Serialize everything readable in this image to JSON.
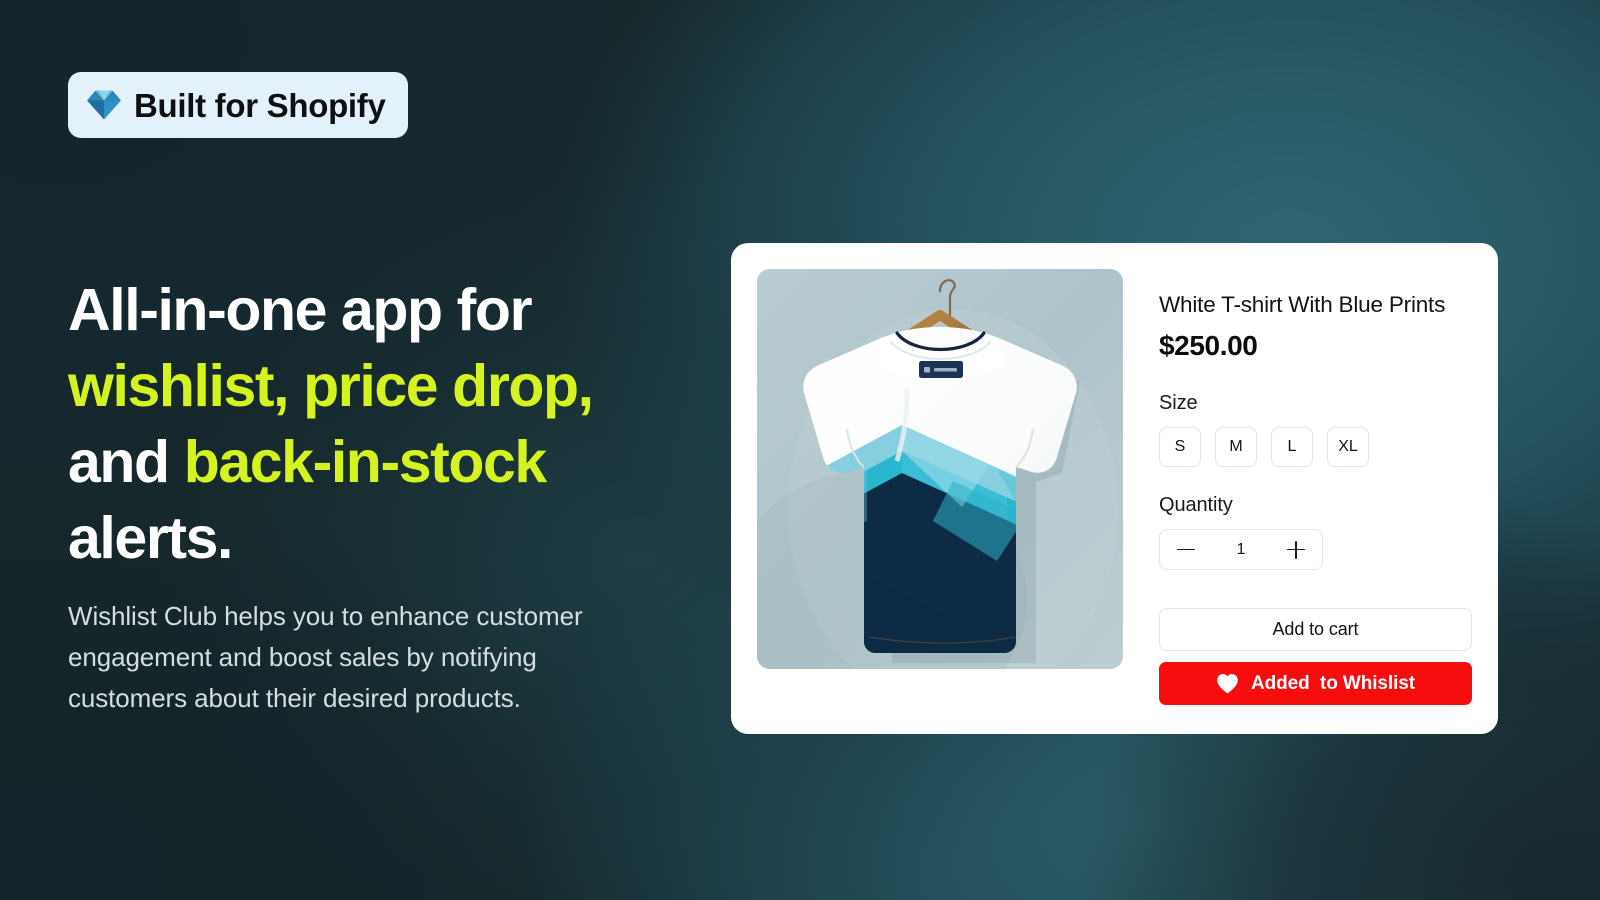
{
  "badge": {
    "icon": "gem-diamond-icon",
    "label": "Built for Shopify"
  },
  "hero": {
    "headline_parts": [
      {
        "text": "All-in-one app for ",
        "color": "#ffffff"
      },
      {
        "text": "wishlist, price drop,",
        "color": "#d4f320"
      },
      {
        "text": " and ",
        "color": "#ffffff"
      },
      {
        "text": "back-in-stock",
        "color": "#d4f320"
      },
      {
        "text": " alerts.",
        "color": "#ffffff"
      }
    ],
    "headline_line1": "All-in-one app for",
    "headline_line2": "wishlist, price drop,",
    "headline_line3_white": "and ",
    "headline_line3_lime": "back-in-stock",
    "headline_line4": "alerts.",
    "subtext": "Wishlist Club helps you to enhance customer engagement and boost sales by notifying customers about their desired products."
  },
  "product": {
    "image_alt": "White t-shirt with blue chevron prints on a wooden hanger",
    "title": "White T-shirt With Blue Prints",
    "price": "$250.00",
    "size_label": "Size",
    "sizes": [
      "S",
      "M",
      "L",
      "XL"
    ],
    "quantity_label": "Quantity",
    "quantity_value": "1",
    "decrement_icon": "minus-icon",
    "increment_icon": "plus-icon",
    "add_to_cart_label": "Add to cart",
    "wishlist_label": "Added  to Whislist",
    "wishlist_icon": "heart-filled-icon"
  },
  "colors": {
    "background_dark": "#16282b",
    "background_teal": "#2a5c68",
    "accent_lime": "#d4f320",
    "wishlist_red": "#f70d0d",
    "badge_bg": "#e3f1fb",
    "card_bg": "#ffffff",
    "border_light": "#dde6ee"
  }
}
